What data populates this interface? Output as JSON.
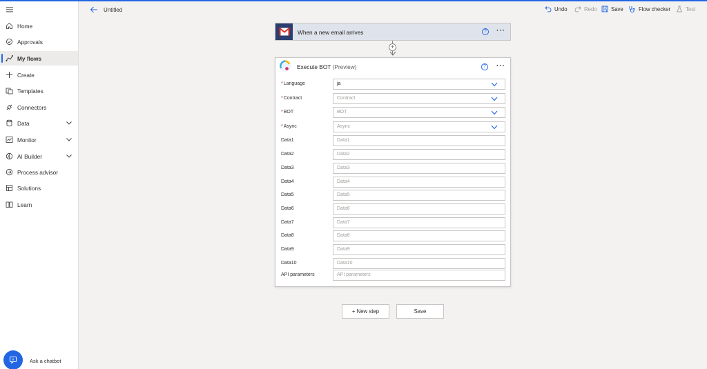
{
  "header": {
    "title": "Untitled",
    "undo": "Undo",
    "redo": "Redo",
    "save": "Save",
    "flow_checker": "Flow checker",
    "test": "Test"
  },
  "sidebar": {
    "items": [
      {
        "label": "Home",
        "icon": "home-icon"
      },
      {
        "label": "Approvals",
        "icon": "approvals-icon"
      },
      {
        "label": "My flows",
        "icon": "flows-icon",
        "active": true
      },
      {
        "label": "Create",
        "icon": "plus-icon"
      },
      {
        "label": "Templates",
        "icon": "templates-icon"
      },
      {
        "label": "Connectors",
        "icon": "connectors-icon"
      },
      {
        "label": "Data",
        "icon": "data-icon",
        "expandable": true
      },
      {
        "label": "Monitor",
        "icon": "monitor-icon",
        "expandable": true
      },
      {
        "label": "AI Builder",
        "icon": "ai-builder-icon",
        "expandable": true
      },
      {
        "label": "Process advisor",
        "icon": "process-advisor-icon"
      },
      {
        "label": "Solutions",
        "icon": "solutions-icon"
      },
      {
        "label": "Learn",
        "icon": "learn-icon"
      }
    ],
    "chatbot": "Ask a chatbot"
  },
  "trigger": {
    "title": "When a new email arrives",
    "help": "?"
  },
  "action": {
    "title": "Execute BOT",
    "subtitle": "(Preview)",
    "help": "?",
    "fields": [
      {
        "label": "Language",
        "required": true,
        "value": "ja",
        "placeholder": "",
        "dropdown": true
      },
      {
        "label": "Contract",
        "required": true,
        "value": "",
        "placeholder": "Contract",
        "dropdown": true
      },
      {
        "label": "BOT",
        "required": true,
        "value": "",
        "placeholder": "BOT",
        "dropdown": true
      },
      {
        "label": "Async",
        "required": true,
        "value": "",
        "placeholder": "Async",
        "dropdown": true
      },
      {
        "label": "Data1",
        "required": false,
        "value": "",
        "placeholder": "Data1"
      },
      {
        "label": "Data2",
        "required": false,
        "value": "",
        "placeholder": "Data2"
      },
      {
        "label": "Data3",
        "required": false,
        "value": "",
        "placeholder": "Data3"
      },
      {
        "label": "Data4",
        "required": false,
        "value": "",
        "placeholder": "Data4"
      },
      {
        "label": "Data5",
        "required": false,
        "value": "",
        "placeholder": "Data5"
      },
      {
        "label": "Data6",
        "required": false,
        "value": "",
        "placeholder": "Data6"
      },
      {
        "label": "Data7",
        "required": false,
        "value": "",
        "placeholder": "Data7"
      },
      {
        "label": "Data8",
        "required": false,
        "value": "",
        "placeholder": "Data8"
      },
      {
        "label": "Data9",
        "required": false,
        "value": "",
        "placeholder": "Data9"
      },
      {
        "label": "Data10",
        "required": false,
        "value": "",
        "placeholder": "Data10"
      },
      {
        "label": "API parameters",
        "required": false,
        "value": "",
        "placeholder": "API parameters"
      }
    ]
  },
  "buttons": {
    "new_step": "+ New step",
    "save": "Save"
  },
  "colors": {
    "accent": "#2266e3",
    "required": "#a4262c",
    "gmail_bg": "#2c3e6e",
    "trigger_bg": "#dfe3ec"
  }
}
